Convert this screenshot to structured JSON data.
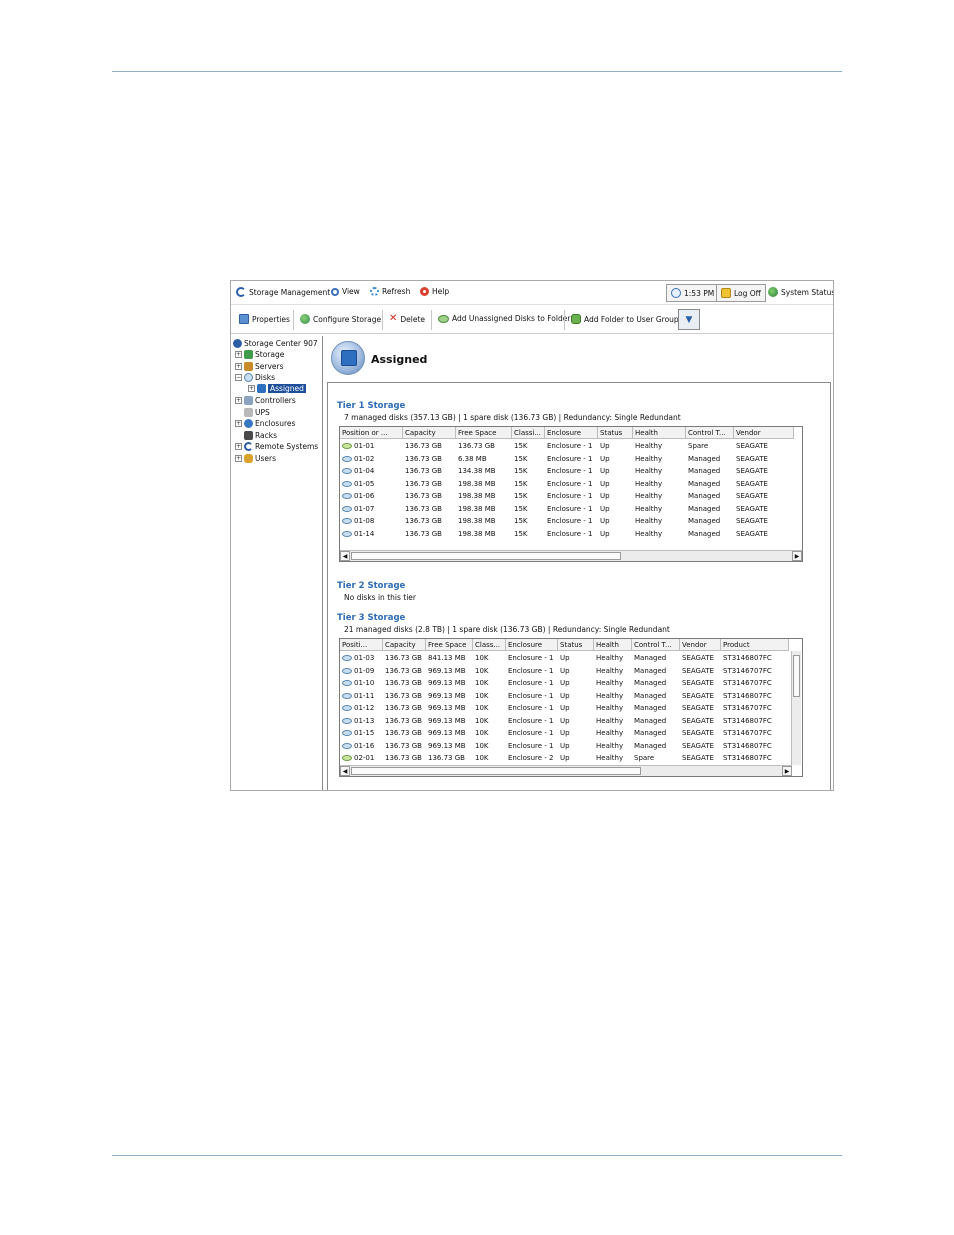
{
  "menubar": {
    "items": [
      "Storage Management",
      "View",
      "Refresh",
      "Help"
    ],
    "clock": "1:53 PM",
    "logoff": "Log Off",
    "system_status": "System Status"
  },
  "toolbar": {
    "properties": "Properties",
    "configure_storage": "Configure Storage",
    "delete": "Delete",
    "add_unassigned": "Add Unassigned Disks to Folder",
    "add_folder_user_group": "Add Folder to User Group"
  },
  "tree": {
    "root": "Storage Center 907",
    "items": [
      "Storage",
      "Servers",
      "Disks",
      "Assigned",
      "Controllers",
      "UPS",
      "Enclosures",
      "Racks",
      "Remote Systems",
      "Users"
    ]
  },
  "page": {
    "title": "Assigned"
  },
  "tier1": {
    "title": "Tier 1 Storage",
    "summary": "7 managed disks (357.13 GB) | 1 spare disk (136.73 GB) | Redundancy: Single Redundant",
    "columns": [
      "Position or ...",
      "Capacity",
      "Free Space",
      "Classi...",
      "Enclosure",
      "Status",
      "Health",
      "Control T...",
      "Vendor"
    ],
    "rows": [
      [
        "01-01",
        "136.73 GB",
        "136.73 GB",
        "15K",
        "Enclosure - 1",
        "Up",
        "Healthy",
        "Spare",
        "SEAGATE"
      ],
      [
        "01-02",
        "136.73 GB",
        "6.38 MB",
        "15K",
        "Enclosure - 1",
        "Up",
        "Healthy",
        "Managed",
        "SEAGATE"
      ],
      [
        "01-04",
        "136.73 GB",
        "134.38 MB",
        "15K",
        "Enclosure - 1",
        "Up",
        "Healthy",
        "Managed",
        "SEAGATE"
      ],
      [
        "01-05",
        "136.73 GB",
        "198.38 MB",
        "15K",
        "Enclosure - 1",
        "Up",
        "Healthy",
        "Managed",
        "SEAGATE"
      ],
      [
        "01-06",
        "136.73 GB",
        "198.38 MB",
        "15K",
        "Enclosure - 1",
        "Up",
        "Healthy",
        "Managed",
        "SEAGATE"
      ],
      [
        "01-07",
        "136.73 GB",
        "198.38 MB",
        "15K",
        "Enclosure - 1",
        "Up",
        "Healthy",
        "Managed",
        "SEAGATE"
      ],
      [
        "01-08",
        "136.73 GB",
        "198.38 MB",
        "15K",
        "Enclosure - 1",
        "Up",
        "Healthy",
        "Managed",
        "SEAGATE"
      ],
      [
        "01-14",
        "136.73 GB",
        "198.38 MB",
        "15K",
        "Enclosure - 1",
        "Up",
        "Healthy",
        "Managed",
        "SEAGATE"
      ]
    ]
  },
  "tier2": {
    "title": "Tier 2 Storage",
    "summary": "No disks in this tier"
  },
  "tier3": {
    "title": "Tier 3 Storage",
    "summary": "21 managed disks (2.8 TB) | 1 spare disk (136.73 GB) | Redundancy: Single Redundant",
    "columns": [
      "Positi...",
      "Capacity",
      "Free Space",
      "Class...",
      "Enclosure",
      "Status",
      "Health",
      "Control T...",
      "Vendor",
      "Product"
    ],
    "rows": [
      [
        "01-03",
        "136.73 GB",
        "841.13 MB",
        "10K",
        "Enclosure - 1",
        "Up",
        "Healthy",
        "Managed",
        "SEAGATE",
        "ST3146807FC"
      ],
      [
        "01-09",
        "136.73 GB",
        "969.13 MB",
        "10K",
        "Enclosure - 1",
        "Up",
        "Healthy",
        "Managed",
        "SEAGATE",
        "ST3146707FC"
      ],
      [
        "01-10",
        "136.73 GB",
        "969.13 MB",
        "10K",
        "Enclosure - 1",
        "Up",
        "Healthy",
        "Managed",
        "SEAGATE",
        "ST3146707FC"
      ],
      [
        "01-11",
        "136.73 GB",
        "969.13 MB",
        "10K",
        "Enclosure - 1",
        "Up",
        "Healthy",
        "Managed",
        "SEAGATE",
        "ST3146807FC"
      ],
      [
        "01-12",
        "136.73 GB",
        "969.13 MB",
        "10K",
        "Enclosure - 1",
        "Up",
        "Healthy",
        "Managed",
        "SEAGATE",
        "ST3146707FC"
      ],
      [
        "01-13",
        "136.73 GB",
        "969.13 MB",
        "10K",
        "Enclosure - 1",
        "Up",
        "Healthy",
        "Managed",
        "SEAGATE",
        "ST3146807FC"
      ],
      [
        "01-15",
        "136.73 GB",
        "969.13 MB",
        "10K",
        "Enclosure - 1",
        "Up",
        "Healthy",
        "Managed",
        "SEAGATE",
        "ST3146707FC"
      ],
      [
        "01-16",
        "136.73 GB",
        "969.13 MB",
        "10K",
        "Enclosure - 1",
        "Up",
        "Healthy",
        "Managed",
        "SEAGATE",
        "ST3146807FC"
      ],
      [
        "02-01",
        "136.73 GB",
        "136.73 GB",
        "10K",
        "Enclosure - 2",
        "Up",
        "Healthy",
        "Spare",
        "SEAGATE",
        "ST3146807FC"
      ]
    ]
  }
}
